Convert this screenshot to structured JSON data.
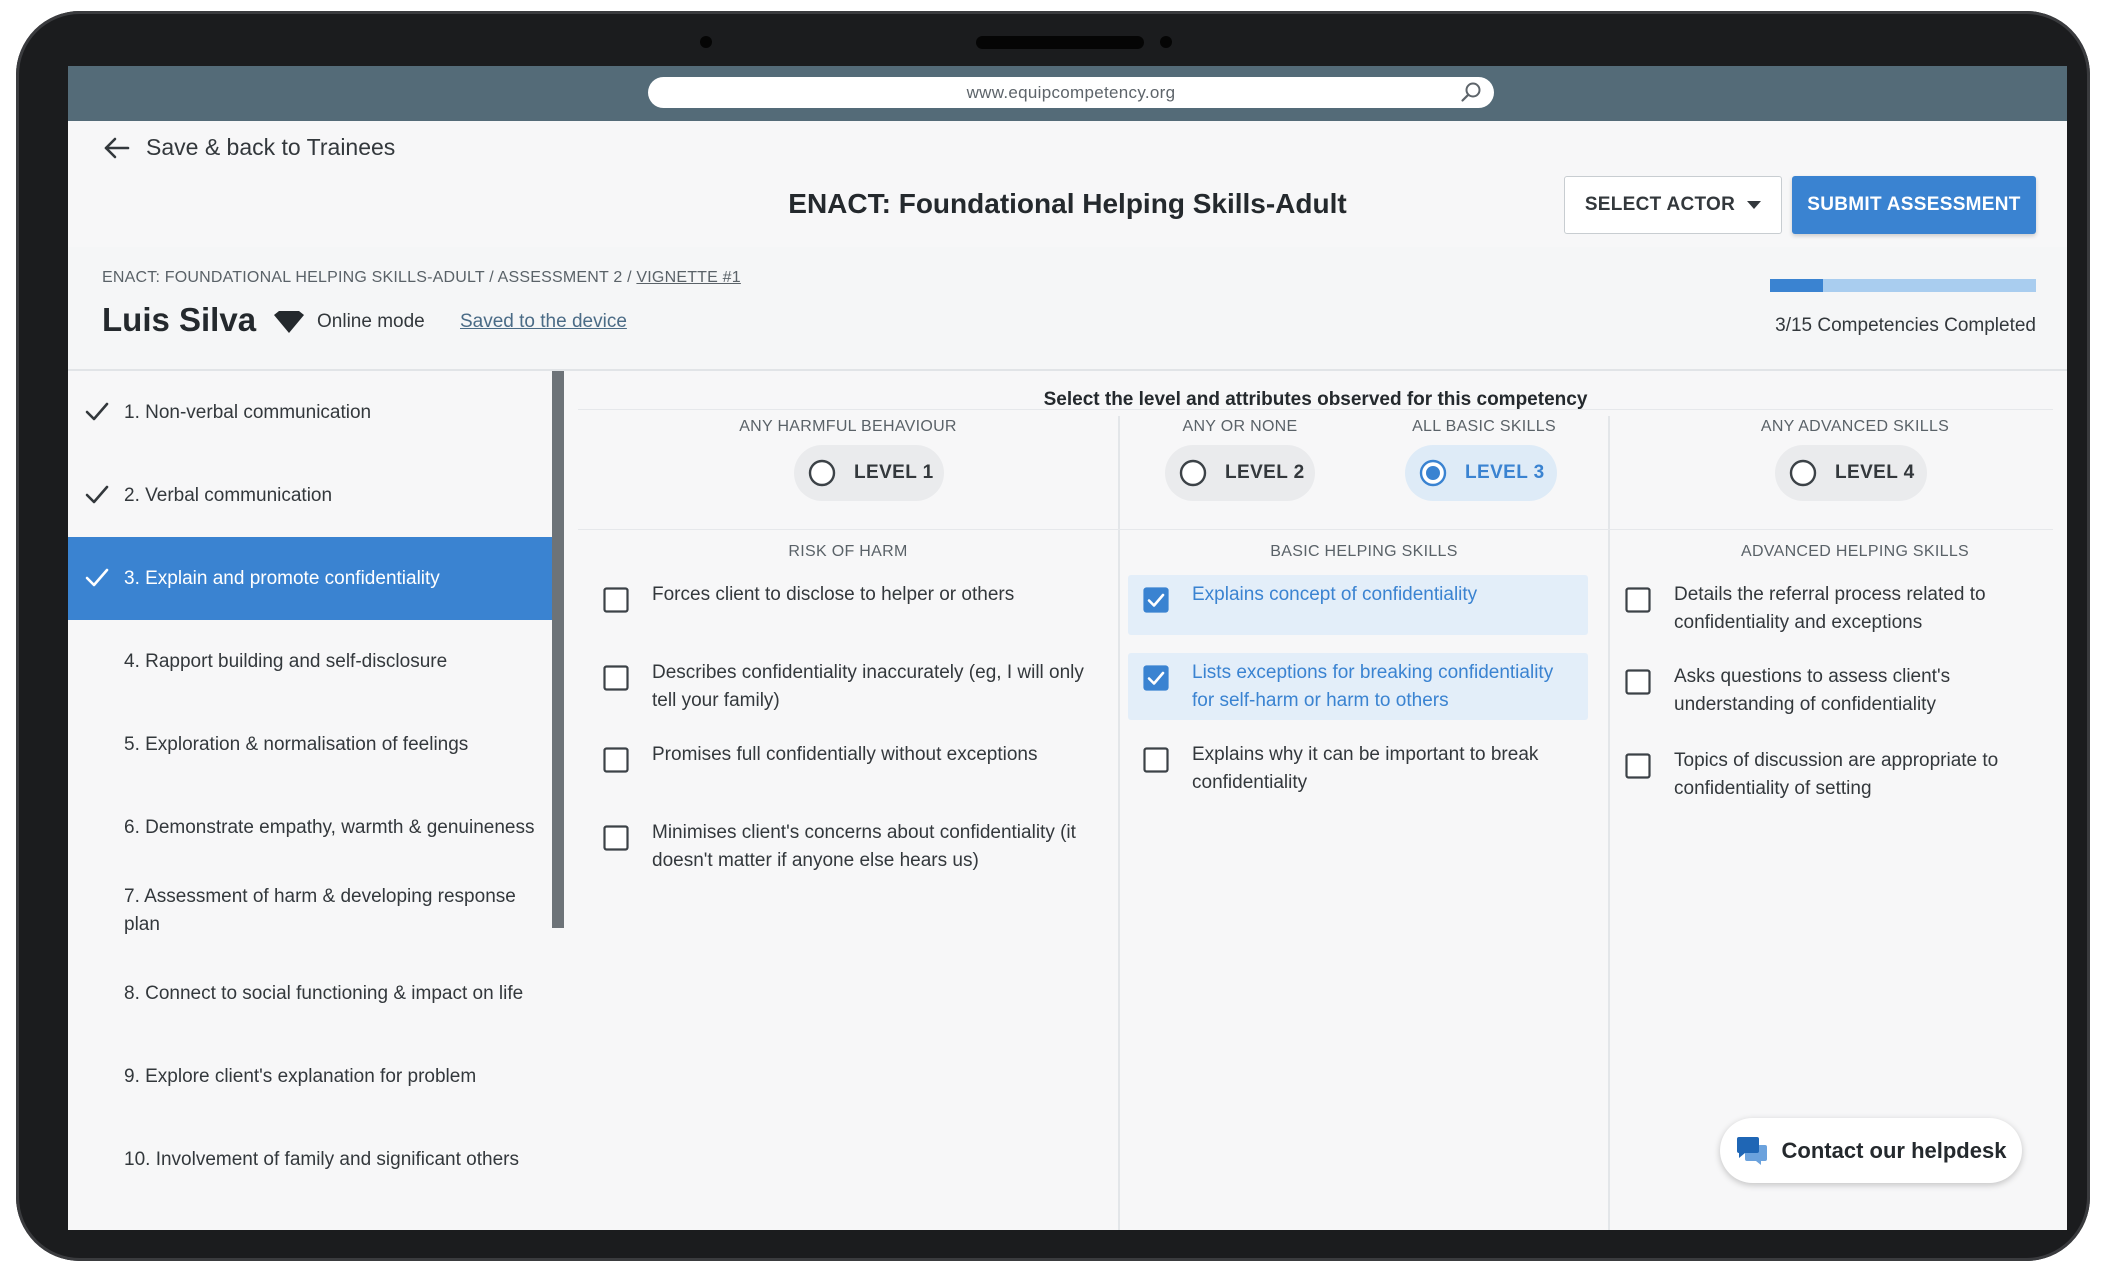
{
  "browser": {
    "url": "www.equipcompetency.org"
  },
  "topbar": {
    "back_label": "Save & back to Trainees",
    "title": "ENACT: Foundational Helping Skills-Adult",
    "select_actor_label": "SELECT ACTOR",
    "submit_label": "SUBMIT ASSESSMENT"
  },
  "breadcrumb": {
    "path": "ENACT: FOUNDATIONAL HELPING SKILLS-ADULT / ASSESSMENT 2 / ",
    "current": "VIGNETTE #1"
  },
  "trainee": {
    "name": "Luis Silva",
    "mode": "Online mode",
    "saved_status": "Saved to the device"
  },
  "progress": {
    "completed": 3,
    "total": 15,
    "label": "3/15 Competencies Completed"
  },
  "sidebar": {
    "items": [
      {
        "label": "1. Non-verbal communication",
        "done": true
      },
      {
        "label": "2. Verbal communication",
        "done": true
      },
      {
        "label": "3. Explain and promote confidentiality",
        "done": true,
        "active": true
      },
      {
        "label": "4. Rapport building and self-disclosure",
        "done": false
      },
      {
        "label": "5. Exploration & normalisation of feelings",
        "done": false
      },
      {
        "label": "6. Demonstrate empathy, warmth & genuineness",
        "done": false
      },
      {
        "label": "7. Assessment of harm & developing response plan",
        "done": false
      },
      {
        "label": "8. Connect to social functioning & impact on life",
        "done": false
      },
      {
        "label": "9. Explore client's explanation for problem",
        "done": false
      },
      {
        "label": "10. Involvement of family and significant others",
        "done": false
      }
    ]
  },
  "assessment": {
    "instruction": "Select the level and attributes observed for this competency",
    "columns": [
      {
        "level_header": "ANY HARMFUL BEHAVIOUR",
        "level": "LEVEL 1",
        "selected": false,
        "section": "RISK OF HARM"
      },
      {
        "level_header": "ANY OR NONE",
        "level": "LEVEL 2",
        "selected": false,
        "section": "BASIC HELPING SKILLS"
      },
      {
        "level_header": "ALL BASIC SKILLS",
        "level": "LEVEL 3",
        "selected": true,
        "section": ""
      },
      {
        "level_header": "ANY ADVANCED SKILLS",
        "level": "LEVEL 4",
        "selected": false,
        "section": "ADVANCED HELPING SKILLS"
      }
    ],
    "risk_items": [
      {
        "text": "Forces client to disclose to helper or others",
        "checked": false
      },
      {
        "text": "Describes confidentiality inaccurately (eg, I will only tell your family)",
        "checked": false
      },
      {
        "text": "Promises full confidentially without exceptions",
        "checked": false
      },
      {
        "text": "Minimises client's concerns about confidentiality (it doesn't matter if anyone else hears us)",
        "checked": false
      }
    ],
    "basic_items": [
      {
        "text": "Explains concept of confidentiality",
        "checked": true
      },
      {
        "text": "Lists exceptions for breaking confidentiality for self-harm or harm to others",
        "checked": true
      },
      {
        "text": "Explains why it can be important to break confidentiality",
        "checked": false
      }
    ],
    "advanced_items": [
      {
        "text": "Details the referral process related to confidentiality and exceptions",
        "checked": false
      },
      {
        "text": "Asks questions to assess client's understanding of confidentiality",
        "checked": false
      },
      {
        "text": "Topics of discussion are appropriate to confidentiality of setting",
        "checked": false
      }
    ]
  },
  "helpdesk": {
    "label": "Contact our helpdesk"
  },
  "colors": {
    "accent": "#3a83d1",
    "accent_light": "#e3eef9",
    "browser_bar": "#546b78",
    "device_frame": "#1b1c1e"
  },
  "icons": {
    "back": "arrow-left-icon",
    "search": "search-icon",
    "mode": "diamond-icon",
    "done": "checkmark-icon",
    "helpdesk": "chat-bubbles-icon"
  }
}
